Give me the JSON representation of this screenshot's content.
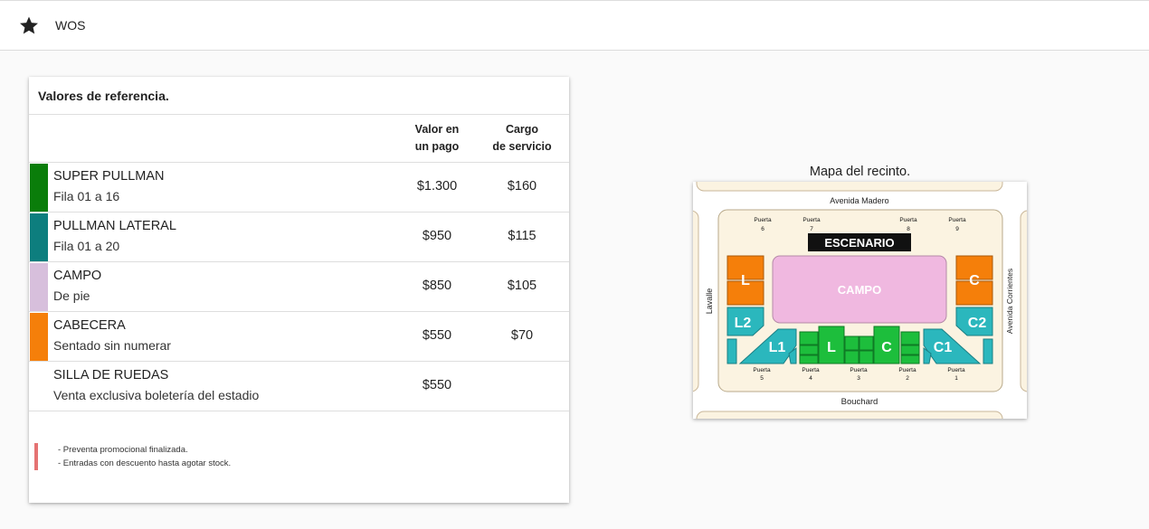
{
  "header": {
    "title": "WOS",
    "icon": "star-icon"
  },
  "prices": {
    "title": "Valores de referencia.",
    "col_price": [
      "Valor en",
      "un pago"
    ],
    "col_fee": [
      "Cargo",
      "de servicio"
    ],
    "rows": [
      {
        "name": "SUPER PULLMAN",
        "sub": "Fila 01 a 16",
        "price": "$1.300",
        "fee": "$160",
        "color": "#0a7d0a"
      },
      {
        "name": "PULLMAN LATERAL",
        "sub": "Fila 01 a 20",
        "price": "$950",
        "fee": "$115",
        "color": "#0d7e7e"
      },
      {
        "name": "CAMPO",
        "sub": "De pie",
        "price": "$850",
        "fee": "$105",
        "color": "#d7bfdc"
      },
      {
        "name": "CABECERA",
        "sub": "Sentado sin numerar",
        "price": "$550",
        "fee": "$70",
        "color": "#f57f0a"
      },
      {
        "name": "SILLA DE RUEDAS",
        "sub": "Venta exclusiva boletería del estadio",
        "price": "$550",
        "fee": "",
        "color": ""
      }
    ],
    "notes": [
      "- Preventa promocional finalizada.",
      "- Entradas con descuento hasta agotar stock."
    ],
    "note_color": "#e57373"
  },
  "map": {
    "caption": "Mapa del recinto.",
    "streets": {
      "top": "Avenida Madero",
      "bottom": "Bouchard",
      "left": "Lavalle",
      "right": "Avenida Corrientes"
    },
    "stage": "ESCENARIO",
    "gate_word": "Puerta",
    "gates_top": [
      "6",
      "7",
      "8",
      "9"
    ],
    "gates_bottom": [
      "5",
      "4",
      "3",
      "2",
      "1"
    ],
    "sections": {
      "campo": "CAMPO",
      "l": "L",
      "c": "C",
      "l2": "L2",
      "c2": "C2",
      "l1": "L1",
      "c1": "C1",
      "floor_l": "L",
      "floor_c": "C"
    },
    "colors": {
      "bg": "#fbf3e1",
      "orange": "#f57f0a",
      "teal": "#2bb7bd",
      "green": "#1dbe3c",
      "pink": "#f0b8e0"
    }
  }
}
